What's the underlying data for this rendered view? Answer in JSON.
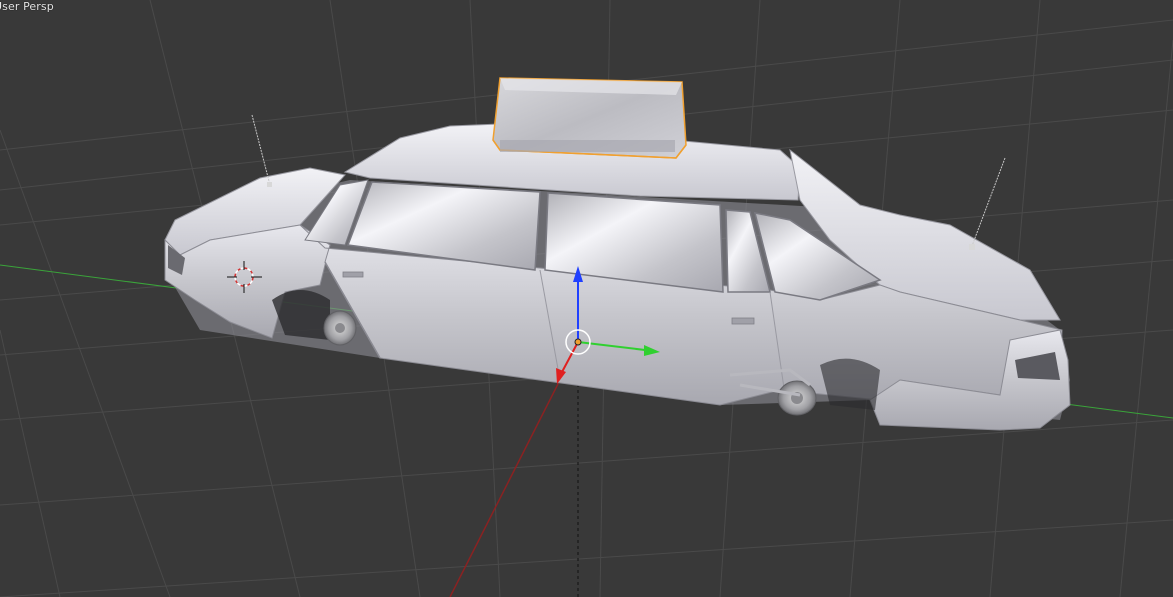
{
  "viewport": {
    "label": "User Persp",
    "background": "#393939",
    "grid_color": "#4a4a4a",
    "x_axis_color": "#d23a3a",
    "y_axis_color": "#3aa43a"
  },
  "scene": {
    "object": "taxi-car-body",
    "selected_part": "roof-sign",
    "selection_outline_color": "#f0a030",
    "body_color": "#c8c8cc"
  },
  "gizmo": {
    "z_color": "#2040ff",
    "y_color": "#30d030",
    "x_color": "#e02020"
  },
  "icons": [
    "3d-cursor-icon",
    "transform-gizmo-icon",
    "origin-point-icon"
  ]
}
